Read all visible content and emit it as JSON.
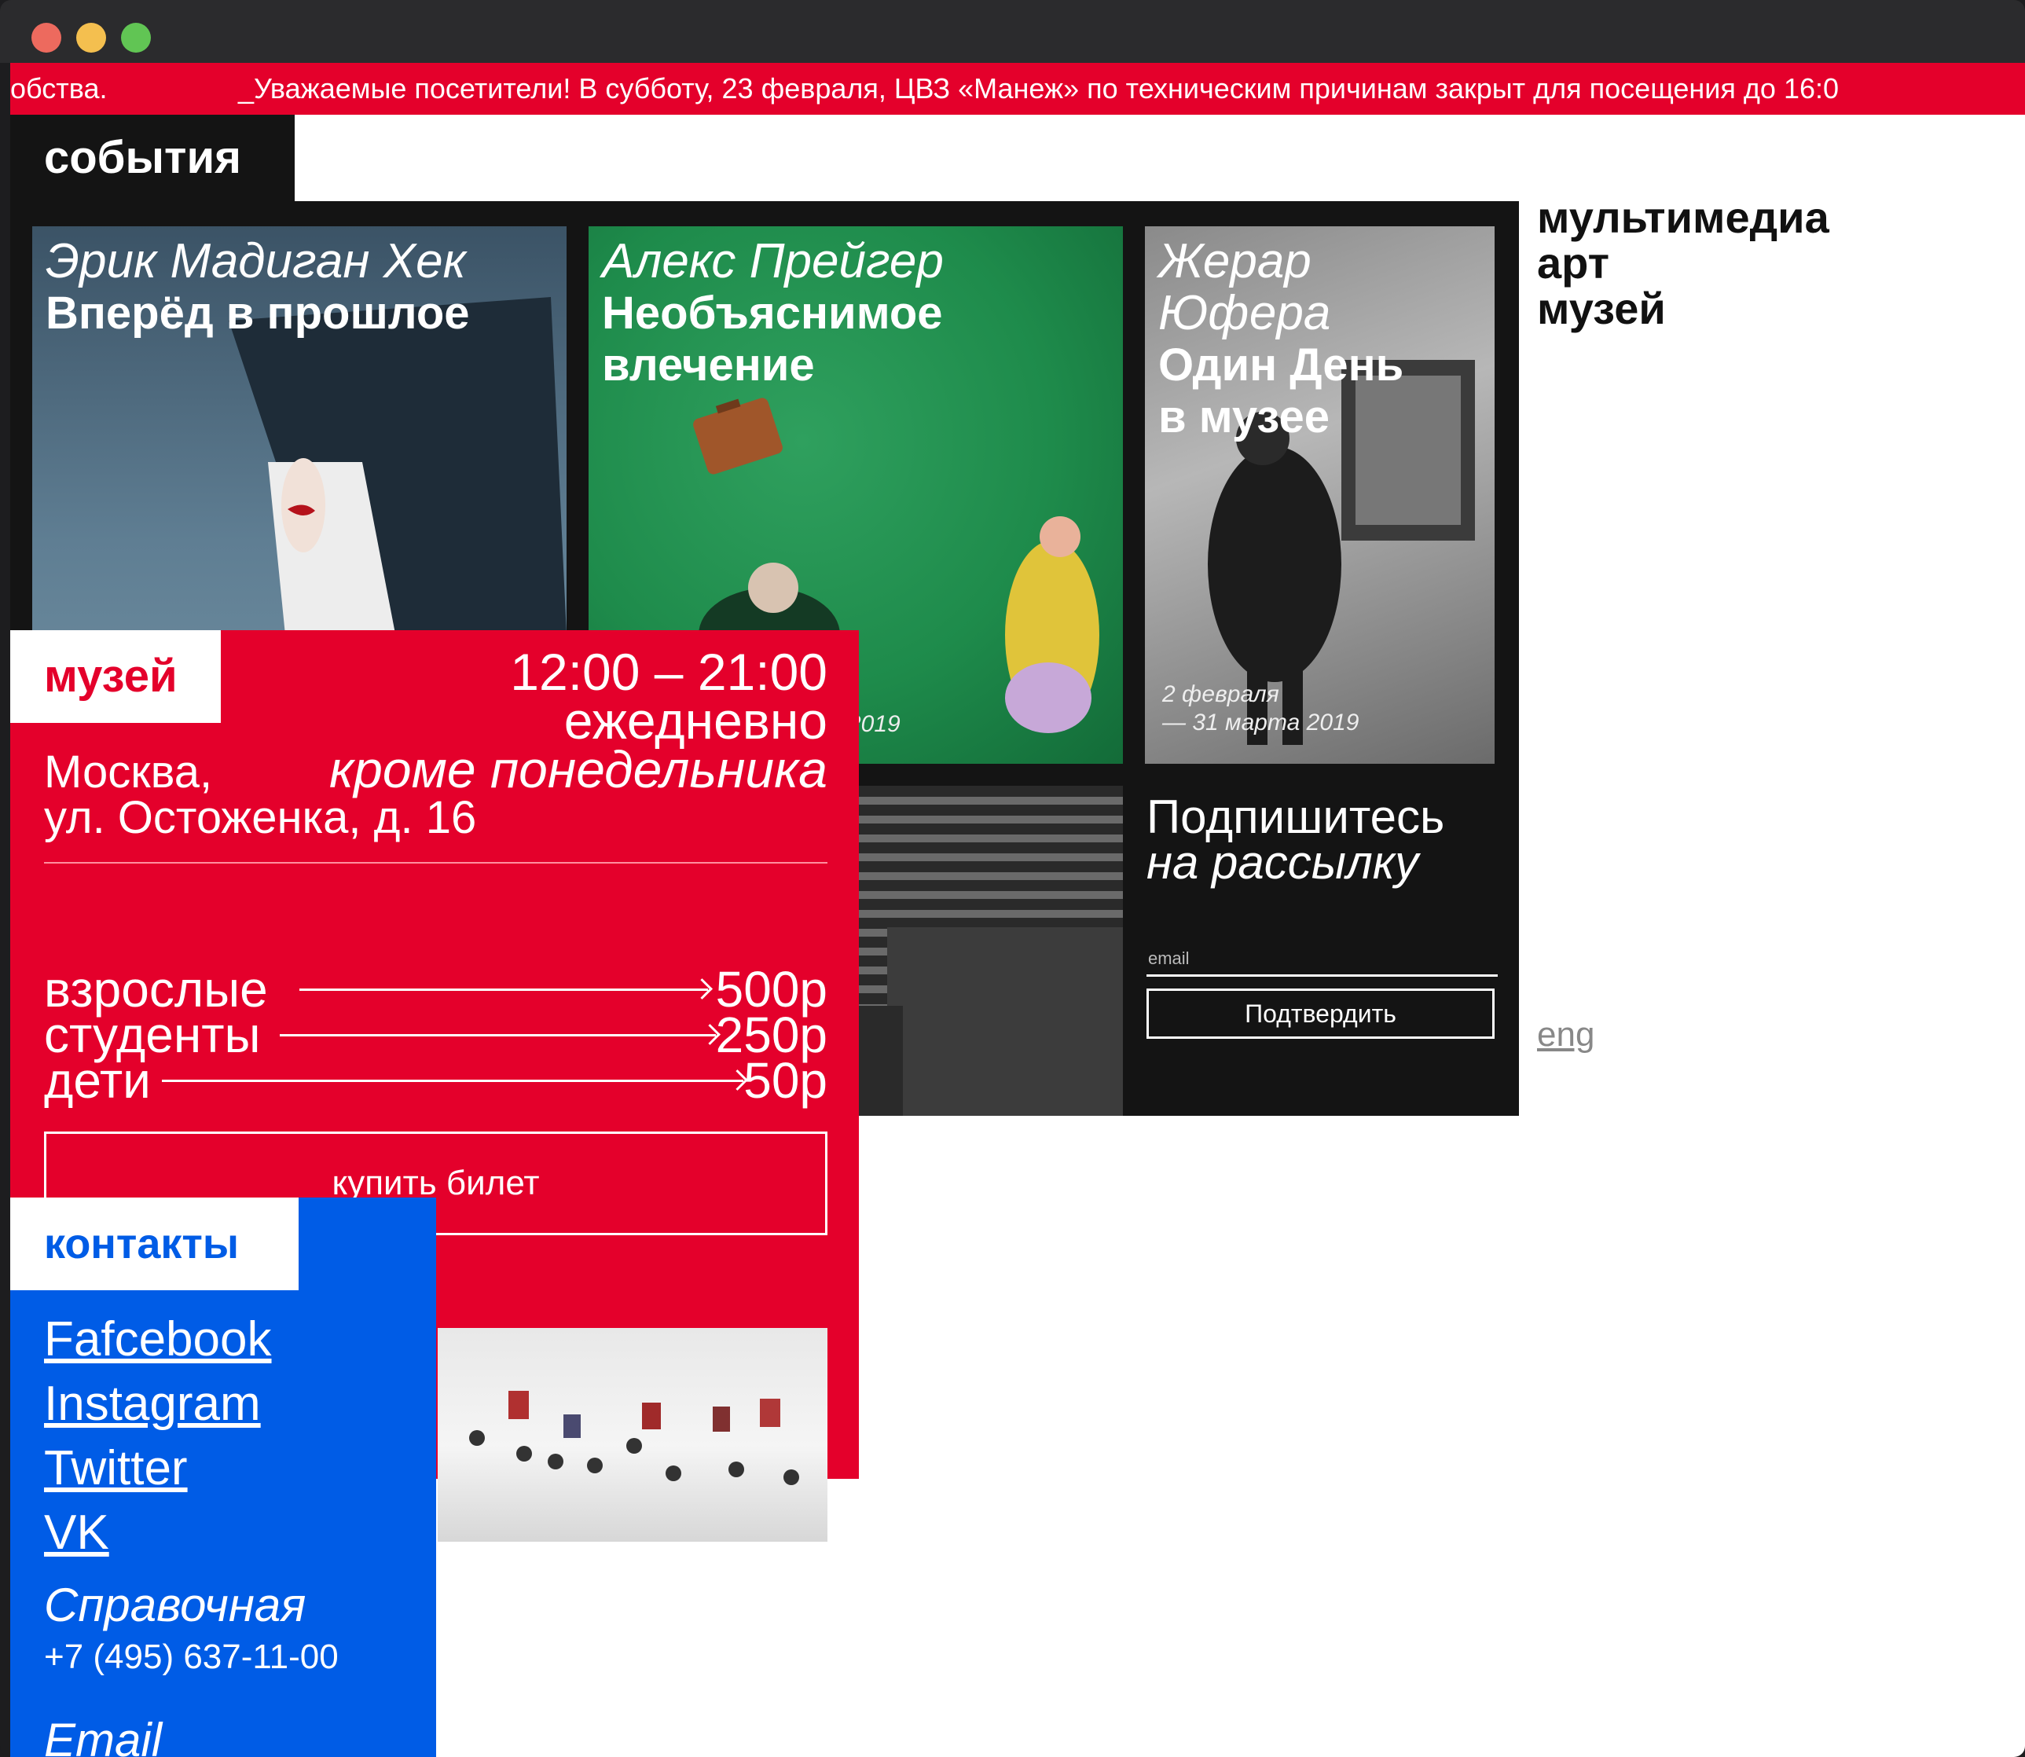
{
  "ticker": {
    "left_fragment": "обства.",
    "message": "_Уважаемые посетители! В субботу, 23 февраля, ЦВЗ «Манеж» по техническим причинам закрыт для посещения до 16:0"
  },
  "events": {
    "tab_label": "события",
    "cards": [
      {
        "author": "Эрик Мадиган Хек",
        "title_line1": "Вперёд в прошлое",
        "title_line2": ""
      },
      {
        "author": "Алекс Прейгер",
        "title_line1": "Необъяснимое",
        "title_line2": "влечение",
        "date_line1": "",
        "date_line2": "2019"
      },
      {
        "author_line1": "Жерар",
        "author_line2": "Юфера",
        "title_line1": "Один День",
        "title_line2": "в музее",
        "date_line1": "2 февраля",
        "date_line2": "— 31 марта 2019"
      }
    ]
  },
  "subscribe": {
    "title": "Подпишитесь",
    "subtitle": "на рассылку",
    "email_placeholder": "email",
    "confirm_label": "Подтвердить"
  },
  "brand": {
    "line1": "мультимедиа",
    "line2": "арт",
    "line3": "музей"
  },
  "lang_switch": "eng",
  "museum": {
    "tab_label": "музей",
    "hours": "12:00 – 21:00",
    "days": "ежедневно",
    "except": "кроме понедельника",
    "city": "Москва,",
    "street": "ул. Остоженка, д. 16",
    "prices": [
      {
        "label": "взрослые",
        "value": "500р"
      },
      {
        "label": "студенты",
        "value": "250р"
      },
      {
        "label": "дети",
        "value": "50р"
      }
    ],
    "buy_label": "купить билет"
  },
  "contacts": {
    "tab_label": "контакты",
    "links": [
      "Fafcebook",
      "Instagram",
      "Twitter",
      "VK"
    ],
    "reference_label": "Справочная",
    "phone": "+7 (495) 637-11-00",
    "email_label": "Email"
  },
  "colors": {
    "accent_red": "#e4002b",
    "accent_blue": "#005ce6",
    "panel_dark": "#141414"
  }
}
